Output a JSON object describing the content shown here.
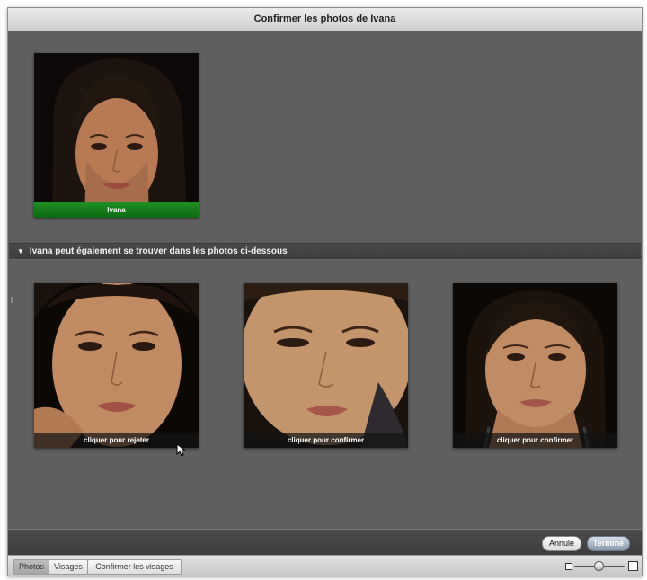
{
  "window": {
    "title": "Confirmer les photos de Ivana"
  },
  "confirmed_photo": {
    "caption": "Ivana"
  },
  "suggestions": {
    "header": "Ivana peut également se trouver dans les photos ci-dessous",
    "photos": [
      {
        "caption": "cliquer pour rejeter"
      },
      {
        "caption": "cliquer pour confirmer"
      },
      {
        "caption": "cliquer pour confirmer"
      }
    ]
  },
  "dialog_buttons": {
    "cancel": "Annule",
    "done": "Terminé"
  },
  "toolbar": {
    "segments": [
      "Photos",
      "Visages"
    ],
    "confirm_faces": "Confirmer les visages"
  },
  "colors": {
    "confirmed_caption": "#1a7f1f",
    "done_button": "#8796aa"
  },
  "icons": [
    "disclosure-triangle-icon",
    "zoom-small-icon",
    "zoom-large-icon",
    "mouse-pointer-icon"
  ]
}
